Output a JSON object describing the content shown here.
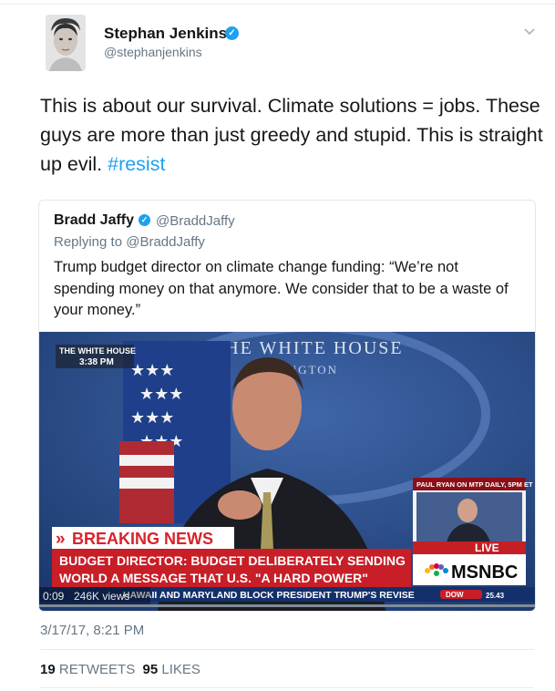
{
  "tweet": {
    "author_name": "Stephan Jenkins",
    "author_handle": "@stephanjenkins",
    "text": "This is about our survival. Climate solutions = jobs. These guys are more than just greedy and stupid. This is straight up evil. ",
    "hashtag": "#resist",
    "timestamp": "3/17/17, 8:21 PM",
    "retweets_count": "19",
    "retweets_label": "RETWEETS",
    "likes_count": "95",
    "likes_label": "LIKES"
  },
  "quote": {
    "author_name": "Bradd Jaffy",
    "author_handle": "@BraddJaffy",
    "replying_to": "Replying to @BraddJaffy",
    "text": "Trump budget director on climate change funding: “We’re not spending money on that anymore. We consider that to be a waste of your money.”"
  },
  "video": {
    "bug_line1": "THE WHITE HOUSE",
    "bug_line2": "3:38 PM",
    "seal_line1": "THE WHITE HOUSE",
    "seal_line2": "HINGTON",
    "inset_label": "PAUL RYAN ON MTP DAILY, 5PM ET",
    "live_label": "LIVE",
    "network": "MSNBC",
    "breaking": "BREAKING NEWS",
    "headline_line1": "BUDGET DIRECTOR: BUDGET DELIBERATELY SENDING",
    "headline_line2": "WORLD A MESSAGE THAT U.S. \"A HARD POWER\"",
    "ticker": "AND MARYLAND BLOCK PRESIDENT TRUMP'S REVISE",
    "ticker_left": "HAWAII",
    "dow_label": "DOW",
    "dow_value": "25.43",
    "time": "0:09",
    "views": "246K views"
  },
  "colors": {
    "accent": "#1da1f2",
    "muted": "#657786",
    "breaking_red": "#d8232a"
  }
}
